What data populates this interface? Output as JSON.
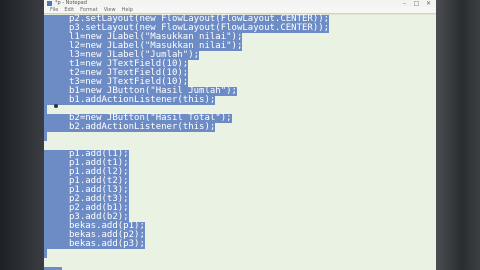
{
  "window": {
    "title": "*p - Notepad",
    "minimize": "–",
    "maximize": "□",
    "close": "✕"
  },
  "menu": [
    "File",
    "Edit",
    "Format",
    "View",
    "Help"
  ],
  "code_lines": [
    "p2.setLayout(new FlowLayout(FlowLayout.CENTER));",
    "p3.setLayout(new FlowLayout(FlowLayout.CENTER));",
    "l1=new JLabel(\"Masukkan nilai\");",
    "l2=new JLabel(\"Masukkan nilai\");",
    "l3=new JLabel(\"Jumlah\");",
    "t1=new JTextField(10);",
    "t2=new JTextField(10);",
    "t3=new JTextField(10);",
    "b1=new JButton(\"Hasil Jumlah\");",
    "b1.addActionListener(this);",
    "",
    "b2=new JButton(\"Hasil Total\");",
    "b2.addActionListener(this);",
    "",
    "p1.add(l1);",
    "p1.add(t1);",
    "p1.add(l2);",
    "p1.add(t2);",
    "p1.add(l3);",
    "p2.add(t3);",
    "p2.add(b1);",
    "p3.add(b2);",
    "bekas.add(p1);",
    "bekas.add(p2);",
    "bekas.add(p3);"
  ]
}
